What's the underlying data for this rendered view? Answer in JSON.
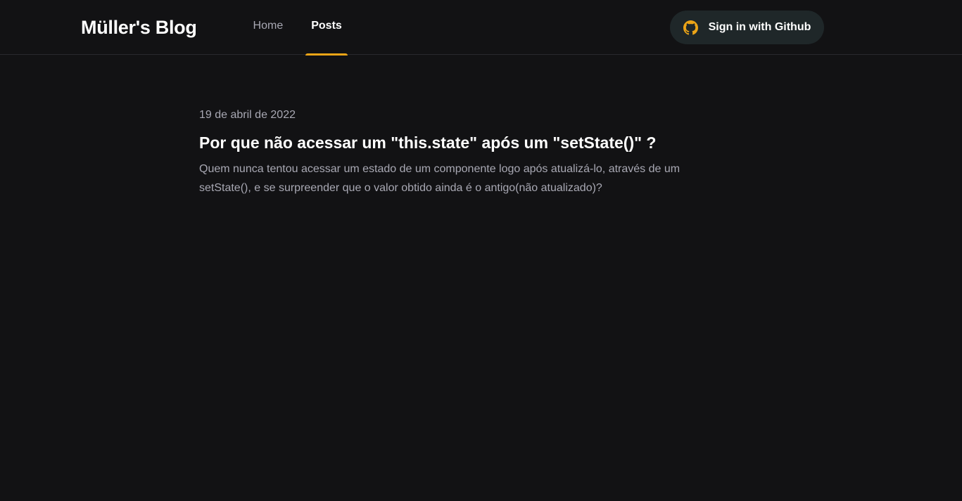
{
  "header": {
    "logo": "Müller's Blog",
    "nav": [
      {
        "label": "Home",
        "active": false
      },
      {
        "label": "Posts",
        "active": true
      }
    ],
    "signin_label": "Sign in with Github",
    "signin_icon": "github-icon"
  },
  "posts": [
    {
      "date": "19 de abril de 2022",
      "title": "Por que não acessar um \"this.state\" após um \"setState()\" ?",
      "excerpt": "Quem nunca tentou acessar um estado de um componente logo após atualizá-lo, através de um setState(), e se surpreender que o valor obtido ainda é o antigo(não atualizado)?"
    }
  ],
  "colors": {
    "background": "#121214",
    "accent": "#eba417",
    "button_bg": "#1f2729",
    "muted_text": "#a8a8b3"
  }
}
